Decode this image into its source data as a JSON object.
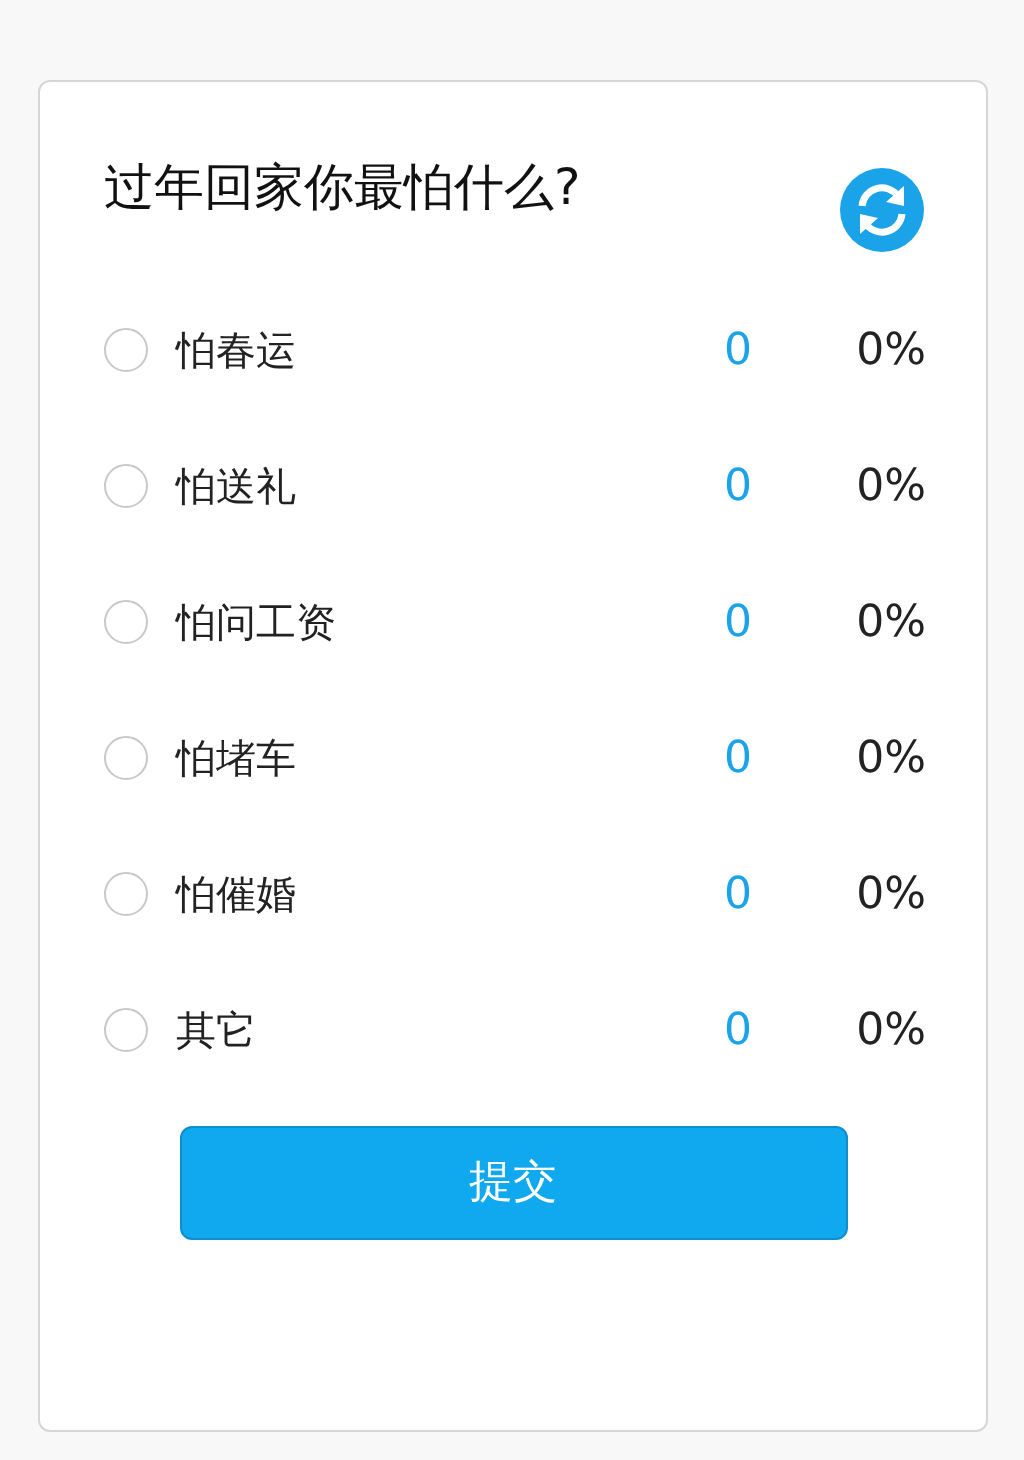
{
  "poll": {
    "title": "过年回家你最怕什么?",
    "options": [
      {
        "label": "怕春运",
        "count": "0",
        "percent": "0%",
        "selected": false
      },
      {
        "label": "怕送礼",
        "count": "0",
        "percent": "0%",
        "selected": false
      },
      {
        "label": "怕问工资",
        "count": "0",
        "percent": "0%",
        "selected": false
      },
      {
        "label": "怕堵车",
        "count": "0",
        "percent": "0%",
        "selected": false
      },
      {
        "label": "怕催婚",
        "count": "0",
        "percent": "0%",
        "selected": false
      },
      {
        "label": "其它",
        "count": "0",
        "percent": "0%",
        "selected": false
      }
    ],
    "submit": "提交"
  }
}
